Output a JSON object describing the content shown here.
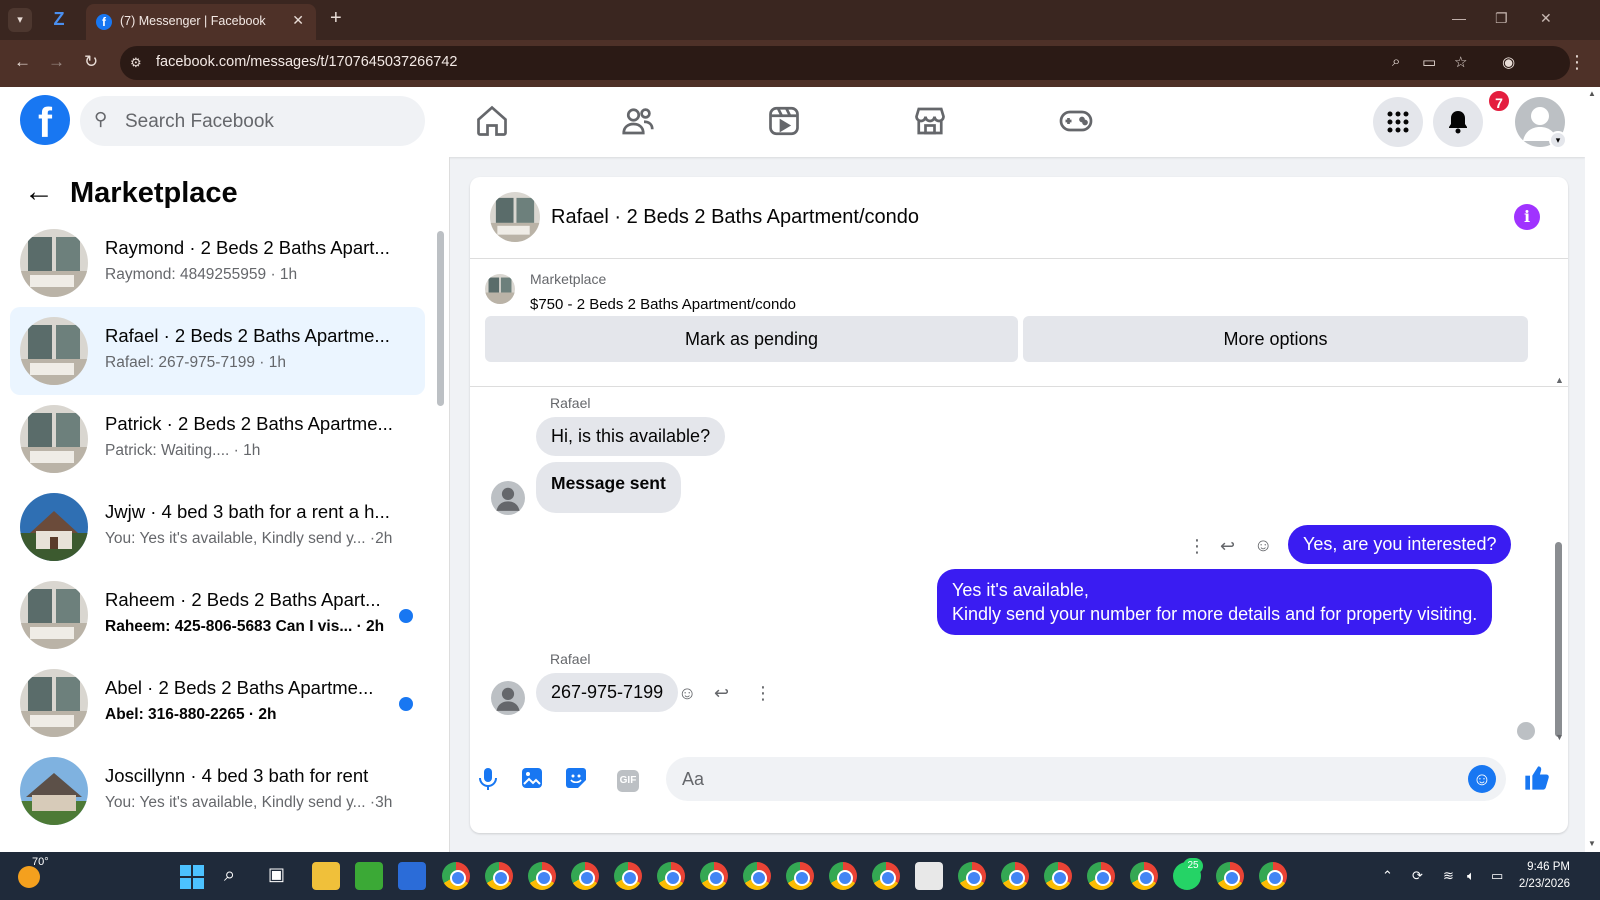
{
  "browser": {
    "tab_title": "(7) Messenger | Facebook",
    "url": "facebook.com/messages/t/1707645037266742",
    "colors": {
      "chrome_bg": "#3a2620",
      "toolbar_bg": "#4e3128"
    }
  },
  "fb": {
    "search_placeholder": "Search Facebook",
    "notifications_count": "7",
    "nav_icons": [
      "home-icon",
      "friends-icon",
      "video-icon",
      "marketplace-icon",
      "gaming-icon"
    ],
    "brand_color": "#1877f2"
  },
  "sidebar": {
    "title": "Marketplace",
    "conversations": [
      {
        "name": "Raymond · 2 Beds 2 Baths Apart...",
        "snippet": "Raymond: 4849255959 · 1h",
        "unread": false,
        "active": false
      },
      {
        "name": "Rafael · 2 Beds 2 Baths Apartme...",
        "snippet": "Rafael: 267-975-7199 · 1h",
        "unread": false,
        "active": true
      },
      {
        "name": "Patrick · 2 Beds 2 Baths Apartme...",
        "snippet": "Patrick: Waiting.... · 1h",
        "unread": false,
        "active": false
      },
      {
        "name": "Jwjw · 4 bed 3 bath for a rent a h...",
        "snippet": "You: Yes it's available, Kindly send y...  ·2h",
        "unread": false,
        "active": false
      },
      {
        "name": "Raheem · 2 Beds 2 Baths Apart...",
        "snippet": "Raheem: 425-806-5683 Can I vis... · 2h",
        "unread": true,
        "active": false
      },
      {
        "name": "Abel · 2 Beds 2 Baths Apartme...",
        "snippet": "Abel: 316-880-2265 · 2h",
        "unread": true,
        "active": false
      },
      {
        "name": "Joscillynn · 4 bed 3 bath for rent",
        "snippet": "You: Yes it's available, Kindly send y...  ·3h",
        "unread": false,
        "active": false
      }
    ]
  },
  "chat": {
    "title": "Rafael · 2 Beds 2 Baths Apartment/condo",
    "listing_source": "Marketplace",
    "listing_name": "$750 - 2 Beds 2 Baths Apartment/condo",
    "mark_pending_label": "Mark as pending",
    "more_options_label": "More options",
    "messages": {
      "sender1": "Rafael",
      "in1": "Hi, is this available?",
      "in2": "Message sent",
      "out1": "Yes, are you interested?",
      "out2_line1": "Yes it's available,",
      "out2_line2": "Kindly send your number for more details and for property visiting.",
      "sender2": "Rafael",
      "in3": "267-975-7199"
    },
    "composer_placeholder": "Aa",
    "outgoing_color": "#3a1cf2"
  },
  "taskbar": {
    "weather_temp": "70°",
    "whatsapp_badge": "25",
    "time": "9:46 PM",
    "date": "2/23/2026"
  }
}
